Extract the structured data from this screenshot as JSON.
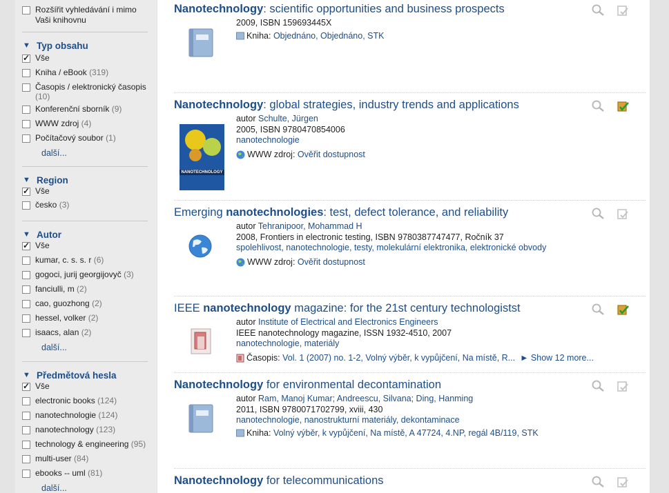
{
  "sidebar": {
    "top_option": {
      "label_line1": "Rozšířit vyhledávání i mimo",
      "label_line2": "Vaši knihovnu"
    },
    "facets": [
      {
        "title": "Typ obsahu",
        "options": [
          {
            "label": "Vše",
            "count": "",
            "checked": true
          },
          {
            "label": "Kniha / eBook",
            "count": "(319)",
            "checked": false
          },
          {
            "label": "Časopis / elektronický časopis",
            "count": "(10)",
            "checked": false
          },
          {
            "label": "Konferenční sborník",
            "count": "(9)",
            "checked": false
          },
          {
            "label": "WWW zdroj",
            "count": "(4)",
            "checked": false
          },
          {
            "label": "Počítačový soubor",
            "count": "(1)",
            "checked": false
          }
        ],
        "more": "další..."
      },
      {
        "title": "Region",
        "options": [
          {
            "label": "Vše",
            "count": "",
            "checked": true
          },
          {
            "label": "česko",
            "count": "(3)",
            "checked": false
          }
        ]
      },
      {
        "title": "Autor",
        "options": [
          {
            "label": "Vše",
            "count": "",
            "checked": true
          },
          {
            "label": "kumar, c. s. s. r",
            "count": "(6)",
            "checked": false
          },
          {
            "label": "gogoci, jurij georgijovyč",
            "count": "(3)",
            "checked": false
          },
          {
            "label": "fanciulli, m",
            "count": "(2)",
            "checked": false
          },
          {
            "label": "cao, guozhong",
            "count": "(2)",
            "checked": false
          },
          {
            "label": "hessel, volker",
            "count": "(2)",
            "checked": false
          },
          {
            "label": "isaacs, alan",
            "count": "(2)",
            "checked": false
          }
        ],
        "more": "další..."
      },
      {
        "title": "Předmětová hesla",
        "options": [
          {
            "label": "Vše",
            "count": "",
            "checked": true
          },
          {
            "label": "electronic books",
            "count": "(124)",
            "checked": false
          },
          {
            "label": "nanotechnologie",
            "count": "(124)",
            "checked": false
          },
          {
            "label": "nanotechnology",
            "count": "(123)",
            "checked": false
          },
          {
            "label": "technology & engineering",
            "count": "(95)",
            "checked": false
          },
          {
            "label": "multi-user",
            "count": "(84)",
            "checked": false
          },
          {
            "label": "ebooks -- uml",
            "count": "(81)",
            "checked": false
          }
        ],
        "more": "další..."
      }
    ]
  },
  "results": [
    {
      "title_pre": "",
      "title_bold": "Nanotechnology",
      "title_rest": ": scientific opportunities and business prospects",
      "cover": "book-icon",
      "author_label": "",
      "author": "",
      "line2": "2009, ISBN 159693445X",
      "tags": "",
      "holding_icon": "book-small-icon",
      "holding_label": "Kniha:",
      "holding_value": "Objednáno, Objednáno, STK",
      "avail": "grey"
    },
    {
      "title_pre": "",
      "title_bold": "Nanotechnology",
      "title_rest": ": global strategies, industry trends and applications",
      "cover": "cover-image",
      "cover_title": "NANOTECHNOLOGY",
      "author_label": "autor",
      "author": "Schulte, Jürgen",
      "line2": "2005, ISBN 9780470854006",
      "tags": "nanotechnologie",
      "holding_icon": "globe-small-icon",
      "holding_label": "WWW zdroj:",
      "holding_value": "Ověřit dostupnost",
      "avail": "green"
    },
    {
      "title_pre": "Emerging ",
      "title_bold": "nanotechnologies",
      "title_rest": ": test, defect tolerance, and reliability",
      "cover": "globe-icon",
      "author_label": "autor",
      "author": "Tehranipoor, Mohammad H",
      "line2": "2008, Frontiers in electronic testing, ISBN 9780387747477, Ročník 37",
      "tags": "spolehlivost, nanotechnologie, testy, molekulární elektronika, elektronické obvody",
      "holding_icon": "globe-small-icon",
      "holding_label": "WWW zdroj:",
      "holding_value": "Ověřit dostupnost",
      "avail": "grey"
    },
    {
      "title_pre": "IEEE ",
      "title_bold": "nanotechnology",
      "title_rest": " magazine: for the 21st century technologistst",
      "cover": "journal-icon",
      "author_label": "autor",
      "author": "Institute of Electrical and Electronics Engineers",
      "line2": "IEEE nanotechnology magazine, ISSN 1932-4510, 2007",
      "tags": "nanotechnologie, materiály",
      "holding_icon": "journal-small-icon",
      "holding_label": "Časopis:",
      "holding_value": "Vol. 1 (2007) no. 1-2, Volný výběr, k vypůjčení, Na místě, R...",
      "show_more": "► Show 12 more...",
      "avail": "green"
    },
    {
      "title_pre": "",
      "title_bold": "Nanotechnology",
      "title_rest": " for environmental decontamination",
      "cover": "book-icon",
      "author_label": "autor",
      "author": "Ram, Manoj Kumar; Andreescu, Silvana; Ding, Hanming",
      "line2": "2011, ISBN 9780071702799, xviii, 430",
      "tags": "nanotechnologie, nanostrukturní materiály, dekontaminace",
      "holding_icon": "book-small-icon",
      "holding_label": "Kniha:",
      "holding_value": "Volný výběr, k vypůjčení, Na místě, A 47724, 4.NP, regál 4B/119, STK",
      "avail": "grey"
    },
    {
      "title_pre": "",
      "title_bold": "Nanotechnology",
      "title_rest": " for telecommunications",
      "cover": "",
      "author_label": "",
      "author": "",
      "line2": "",
      "tags": "",
      "holding_icon": "",
      "holding_label": "",
      "holding_value": "",
      "avail": "grey"
    }
  ]
}
